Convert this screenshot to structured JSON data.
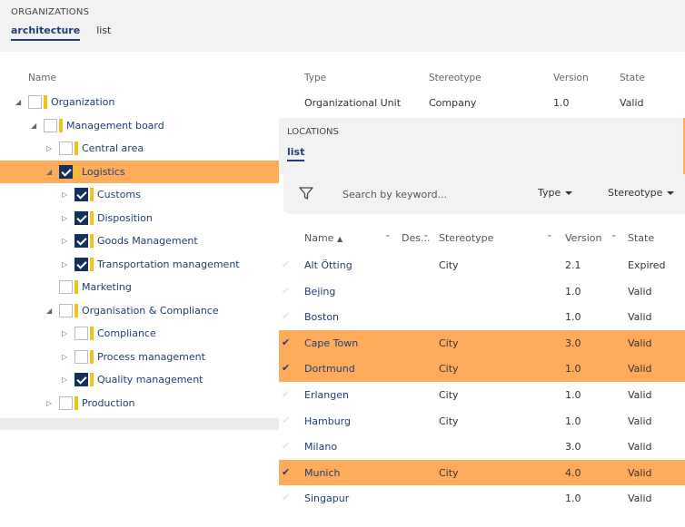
{
  "organizations": {
    "title": "ORGANIZATIONS",
    "tabs": [
      {
        "label": "architecture",
        "active": true
      },
      {
        "label": "list",
        "active": false
      }
    ]
  },
  "tree": {
    "header_name": "Name",
    "items": [
      {
        "label": "Organization",
        "level": 0,
        "toggle": "expanded",
        "checked": false
      },
      {
        "label": "Management board",
        "level": 1,
        "toggle": "expanded",
        "checked": false
      },
      {
        "label": "Central area",
        "level": 2,
        "toggle": "collapsed",
        "checked": false
      },
      {
        "label": "Logistics",
        "level": 2,
        "toggle": "expanded",
        "checked": true,
        "selected": true
      },
      {
        "label": "Customs",
        "level": 3,
        "toggle": "collapsed",
        "checked": true
      },
      {
        "label": "Disposition",
        "level": 3,
        "toggle": "collapsed",
        "checked": true
      },
      {
        "label": "Goods Management",
        "level": 3,
        "toggle": "collapsed",
        "checked": true
      },
      {
        "label": "Transportation management",
        "level": 3,
        "toggle": "collapsed",
        "checked": true
      },
      {
        "label": "Marketing",
        "level": 2,
        "toggle": "none",
        "checked": false
      },
      {
        "label": "Organisation & Compliance",
        "level": 2,
        "toggle": "expanded",
        "checked": false
      },
      {
        "label": "Compliance",
        "level": 3,
        "toggle": "collapsed",
        "checked": false
      },
      {
        "label": "Process management",
        "level": 3,
        "toggle": "collapsed",
        "checked": false
      },
      {
        "label": "Quality management",
        "level": 3,
        "toggle": "collapsed",
        "checked": true
      },
      {
        "label": "Production",
        "level": 2,
        "toggle": "collapsed",
        "checked": false
      }
    ]
  },
  "org_table": {
    "headers": {
      "type": "Type",
      "stereotype": "Stereotype",
      "version": "Version",
      "state": "State"
    },
    "first_row": {
      "type": "Organizational Unit",
      "stereotype": "Company",
      "version": "1.0",
      "state": "Valid"
    }
  },
  "locations": {
    "title": "LOCATIONS",
    "tab": "list",
    "search_placeholder": "Search by keyword...",
    "filter_type": "Type",
    "filter_stereotype": "Stereotype",
    "headers": {
      "name": "Name",
      "description": "Des...",
      "stereotype": "Stereotype",
      "version": "Version",
      "state": "State"
    },
    "rows": [
      {
        "name": "Alt Ötting",
        "stereotype": "City",
        "version": "2.1",
        "state": "Expired",
        "selected": false
      },
      {
        "name": "Bejing",
        "stereotype": "",
        "version": "1.0",
        "state": "Valid",
        "selected": false
      },
      {
        "name": "Boston",
        "stereotype": "",
        "version": "1.0",
        "state": "Valid",
        "selected": false
      },
      {
        "name": "Cape Town",
        "stereotype": "City",
        "version": "3.0",
        "state": "Valid",
        "selected": true
      },
      {
        "name": "Dortmund",
        "stereotype": "City",
        "version": "1.0",
        "state": "Valid",
        "selected": true
      },
      {
        "name": "Erlangen",
        "stereotype": "City",
        "version": "1.0",
        "state": "Valid",
        "selected": false
      },
      {
        "name": "Hamburg",
        "stereotype": "City",
        "version": "1.0",
        "state": "Valid",
        "selected": false
      },
      {
        "name": "Milano",
        "stereotype": "",
        "version": "3.0",
        "state": "Valid",
        "selected": false
      },
      {
        "name": "Munich",
        "stereotype": "City",
        "version": "4.0",
        "state": "Valid",
        "selected": true
      },
      {
        "name": "Singapur",
        "stereotype": "",
        "version": "1.0",
        "state": "Valid",
        "selected": false
      }
    ]
  },
  "colors": {
    "accent": "#1f3f73",
    "selection": "#ffab5c",
    "marker": "#f0c419"
  }
}
